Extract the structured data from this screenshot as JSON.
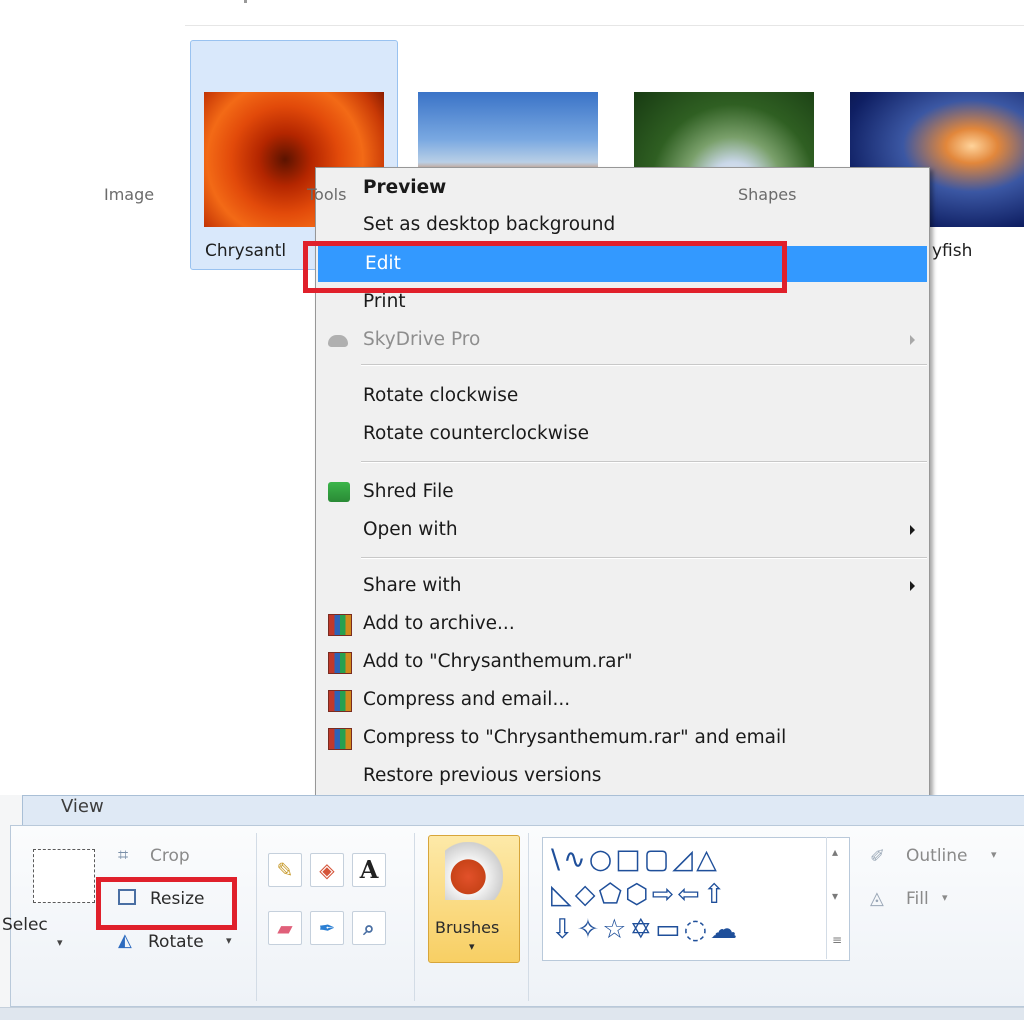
{
  "explorer": {
    "thumbnails": [
      {
        "name": "Chrysanthemum",
        "label": "Chrysantl",
        "selected": true
      },
      {
        "name": "Desert",
        "label": "",
        "selected": false
      },
      {
        "name": "Hydrangeas",
        "label": "",
        "selected": false
      },
      {
        "name": "Jellyfish",
        "label": "yfish",
        "selected": false
      }
    ]
  },
  "context_menu": {
    "items": [
      {
        "label": "Preview",
        "bold": true
      },
      {
        "label": "Set as desktop background"
      },
      {
        "label": "Edit",
        "highlighted": true
      },
      {
        "label": "Print"
      },
      {
        "label": "SkyDrive Pro",
        "disabled": true,
        "icon": "cloud-icon",
        "submenu": true
      },
      {
        "label": "Rotate clockwise"
      },
      {
        "label": "Rotate counterclockwise"
      },
      {
        "label": "Shred File",
        "icon": "shredder-icon"
      },
      {
        "label": "Open with",
        "submenu": true
      },
      {
        "label": "Share with",
        "submenu": true
      },
      {
        "label": "Add to archive...",
        "icon": "winrar-icon"
      },
      {
        "label": "Add to \"Chrysanthemum.rar\"",
        "icon": "winrar-icon"
      },
      {
        "label": "Compress and email...",
        "icon": "winrar-icon"
      },
      {
        "label": "Compress to \"Chrysanthemum.rar\" and email",
        "icon": "winrar-icon"
      },
      {
        "label": "Restore previous versions"
      }
    ],
    "highlight_color": "#3399ff"
  },
  "paint_ribbon": {
    "tab": "View",
    "image_group": {
      "label": "Image",
      "select": "Selec",
      "crop": "Crop",
      "resize": "Resize",
      "rotate": "Rotate"
    },
    "tools_group": {
      "label": "Tools",
      "text_tool": "A"
    },
    "brushes": "Brushes",
    "shapes_group": {
      "label": "Shapes",
      "outline": "Outline",
      "fill": "Fill",
      "rows": [
        "\\∿○□▢◿△",
        "◺◇⬠⬡⇨⇦⇧",
        "⇩✧☆✡▭◌☁"
      ]
    }
  },
  "annotation_color": "#e0202b"
}
